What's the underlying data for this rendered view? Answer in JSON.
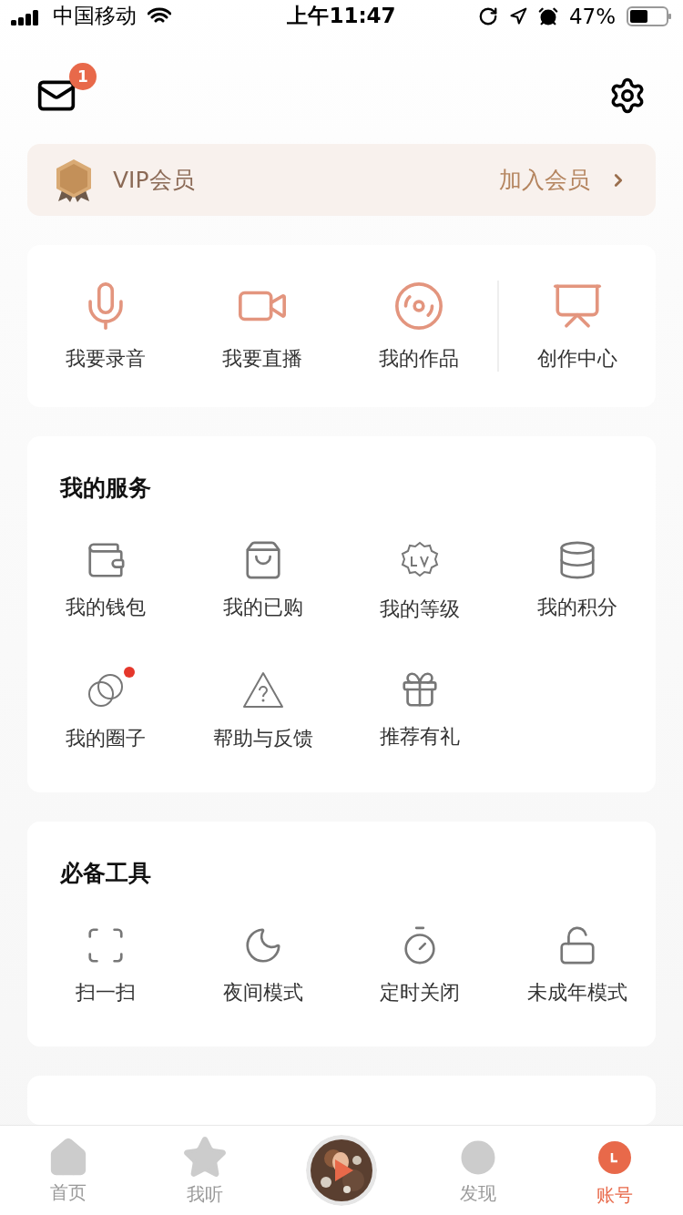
{
  "status_bar": {
    "carrier": "中国移动",
    "time": "上午11:47",
    "battery": "47%"
  },
  "header": {
    "mail_badge": "1"
  },
  "vip": {
    "label": "VIP会员",
    "action": "加入会员"
  },
  "creator": {
    "items": [
      {
        "label": "我要录音"
      },
      {
        "label": "我要直播"
      },
      {
        "label": "我的作品"
      },
      {
        "label": "创作中心"
      }
    ]
  },
  "sections": [
    {
      "title": "我的服务",
      "items": [
        {
          "label": "我的钱包",
          "dot": false
        },
        {
          "label": "我的已购",
          "dot": false
        },
        {
          "label": "我的等级",
          "dot": false
        },
        {
          "label": "我的积分",
          "dot": false
        },
        {
          "label": "我的圈子",
          "dot": true
        },
        {
          "label": "帮助与反馈",
          "dot": false
        },
        {
          "label": "推荐有礼",
          "dot": false
        }
      ]
    },
    {
      "title": "必备工具",
      "items": [
        {
          "label": "扫一扫",
          "dot": false
        },
        {
          "label": "夜间模式",
          "dot": false
        },
        {
          "label": "定时关闭",
          "dot": false
        },
        {
          "label": "未成年模式",
          "dot": false
        }
      ]
    }
  ],
  "tabs": [
    {
      "kind": "tab",
      "label": "首页",
      "selected": false
    },
    {
      "kind": "tab",
      "label": "我听",
      "selected": false
    },
    {
      "kind": "player"
    },
    {
      "kind": "tab",
      "label": "发现",
      "selected": false
    },
    {
      "kind": "tab",
      "label": "账号",
      "selected": true
    }
  ]
}
